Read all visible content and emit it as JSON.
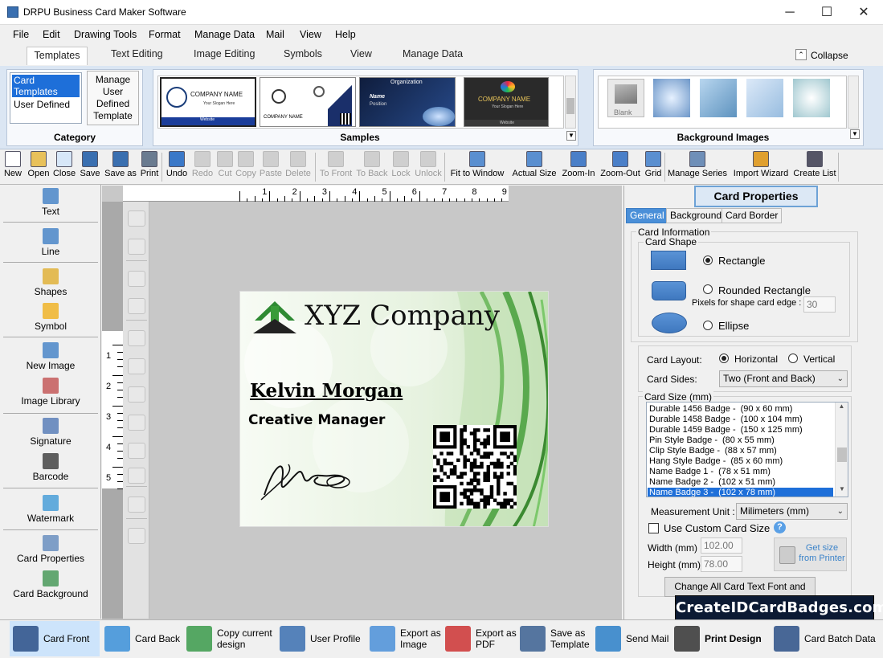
{
  "window": {
    "title": "DRPU Business Card Maker Software",
    "buttons": {
      "minimize": "─",
      "maximize": "☐",
      "close": "✕"
    }
  },
  "menubar": [
    "File",
    "Edit",
    "Drawing Tools",
    "Format",
    "Manage Data",
    "Mail",
    "View",
    "Help"
  ],
  "ribbon_tabs": {
    "active": "Templates",
    "items": [
      "Text Editing",
      "Image Editing",
      "Symbols",
      "View",
      "Manage Data"
    ],
    "collapse": "Collapse"
  },
  "category": {
    "label": "Category",
    "items": [
      "Card Templates",
      "User Defined"
    ],
    "manage_btn": [
      "Manage",
      "User",
      "Defined",
      "Template"
    ]
  },
  "samples": {
    "label": "Samples",
    "thumbs": [
      {
        "company": "COMPANY NAME",
        "slogan": "Your Slogan Here",
        "web": "Website"
      },
      {
        "company": "COMPANY NAME"
      },
      {
        "org": "Organization",
        "name": "Name",
        "pos": "Position"
      },
      {
        "company": "COMPANY NAME",
        "slogan": "Your Slogan Here",
        "web": "Website"
      }
    ]
  },
  "background_images": {
    "label": "Background Images",
    "blank": "Blank"
  },
  "toolbar": [
    {
      "id": "new",
      "label": "New",
      "icon": "new-file-icon",
      "enabled": true
    },
    {
      "id": "open",
      "label": "Open",
      "icon": "folder-icon",
      "enabled": true
    },
    {
      "id": "close",
      "label": "Close",
      "icon": "close-file-icon",
      "enabled": true
    },
    {
      "id": "save",
      "label": "Save",
      "icon": "floppy-icon",
      "enabled": true
    },
    {
      "id": "saveas",
      "label": "Save as",
      "icon": "save-as-icon",
      "enabled": true
    },
    {
      "id": "print",
      "label": "Print",
      "icon": "printer-icon",
      "enabled": true
    },
    {
      "id": "undo",
      "label": "Undo",
      "icon": "undo-icon",
      "enabled": true
    },
    {
      "id": "redo",
      "label": "Redo",
      "icon": "redo-icon",
      "enabled": false
    },
    {
      "id": "cut",
      "label": "Cut",
      "icon": "cut-icon",
      "enabled": false
    },
    {
      "id": "copy",
      "label": "Copy",
      "icon": "copy-icon",
      "enabled": false
    },
    {
      "id": "paste",
      "label": "Paste",
      "icon": "paste-icon",
      "enabled": false
    },
    {
      "id": "delete",
      "label": "Delete",
      "icon": "delete-icon",
      "enabled": false
    },
    {
      "id": "tofront",
      "label": "To Front",
      "icon": "to-front-icon",
      "enabled": false
    },
    {
      "id": "toback",
      "label": "To Back",
      "icon": "to-back-icon",
      "enabled": false
    },
    {
      "id": "lock",
      "label": "Lock",
      "icon": "lock-icon",
      "enabled": false
    },
    {
      "id": "unlock",
      "label": "Unlock",
      "icon": "unlock-icon",
      "enabled": false
    },
    {
      "id": "fit",
      "label": "Fit to Window",
      "icon": "fit-window-icon",
      "enabled": true
    },
    {
      "id": "actual",
      "label": "Actual Size",
      "icon": "actual-size-icon",
      "enabled": true
    },
    {
      "id": "zoomin",
      "label": "Zoom-In",
      "icon": "zoom-in-icon",
      "enabled": true
    },
    {
      "id": "zoomout",
      "label": "Zoom-Out",
      "icon": "zoom-out-icon",
      "enabled": true
    },
    {
      "id": "grid",
      "label": "Grid",
      "icon": "grid-icon",
      "enabled": true
    },
    {
      "id": "series",
      "label": "Manage Series",
      "icon": "manage-series-icon",
      "enabled": true
    },
    {
      "id": "wizard",
      "label": "Import Wizard",
      "icon": "import-wizard-icon",
      "enabled": true
    },
    {
      "id": "createlist",
      "label": "Create List",
      "icon": "create-list-icon",
      "enabled": true
    }
  ],
  "left_tools": [
    "Text",
    "Line",
    "Shapes",
    "Symbol",
    "New Image",
    "Image Library",
    "Signature",
    "Barcode",
    "Watermark",
    "Card Properties",
    "Card Background"
  ],
  "ruler": {
    "h": [
      "1",
      "2",
      "3",
      "4",
      "5",
      "6",
      "7",
      "8",
      "9"
    ],
    "v": [
      "1",
      "2",
      "3",
      "4",
      "5"
    ]
  },
  "card": {
    "company": "XYZ Company",
    "name": "Kelvin Morgan",
    "title": "Creative Manager"
  },
  "card_properties": {
    "title": "Card Properties",
    "tabs": [
      "General",
      "Background",
      "Card Border"
    ],
    "active_tab": "General",
    "card_information": "Card Information",
    "card_shape": "Card Shape",
    "shapes": [
      {
        "label": "Rectangle",
        "selected": true
      },
      {
        "label": "Rounded Rectangle",
        "selected": false
      },
      {
        "label": "Ellipse",
        "selected": false
      }
    ],
    "pixels_label": "Pixels for shape card edge :",
    "pixels_value": "30",
    "layout_label": "Card Layout:",
    "layout_options": [
      {
        "label": "Horizontal",
        "selected": true
      },
      {
        "label": "Vertical",
        "selected": false
      }
    ],
    "sides_label": "Card Sides:",
    "sides_value": "Two (Front and Back)",
    "size_label": "Card Size (mm)",
    "sizes": [
      {
        "name": "Durable 1456  Badge  -",
        "dim": "(90 x 60 mm)"
      },
      {
        "name": "Durable 1458  Badge  -",
        "dim": "(100 x 104 mm)"
      },
      {
        "name": "Durable 1459  Badge  -",
        "dim": "(150 x 125 mm)"
      },
      {
        "name": "Pin Style Badge  -",
        "dim": "(80 x 55 mm)"
      },
      {
        "name": "Clip Style Badge  -",
        "dim": "(88 x 57 mm)"
      },
      {
        "name": "Hang Style Badge  -",
        "dim": "(85 x 60 mm)"
      },
      {
        "name": "Name Badge 1  -",
        "dim": "(78 x 51 mm)"
      },
      {
        "name": "Name Badge 2  -",
        "dim": "(102 x 51 mm)"
      },
      {
        "name": "Name Badge 3  -",
        "dim": "(102 x 78 mm)"
      }
    ],
    "selected_size_index": 8,
    "unit_label": "Measurement Unit :",
    "unit_value": "Milimeters (mm)",
    "custom_size": "Use Custom Card Size",
    "width_label": "Width    (mm)",
    "width_value": "102.00",
    "height_label": "Height  (mm)",
    "height_value": "78.00",
    "get_size": [
      "Get size",
      "from Printer"
    ],
    "change_font": "Change All Card Text Font and Color"
  },
  "bottom_bar": [
    {
      "label": "Card Front",
      "icon": "card-front-icon",
      "selected": true
    },
    {
      "label": "Card Back",
      "icon": "card-back-icon"
    },
    {
      "label": "Copy current\ndesign",
      "icon": "copy-design-icon"
    },
    {
      "label": "User Profile",
      "icon": "user-profile-icon"
    },
    {
      "label": "Export as\nImage",
      "icon": "export-image-icon"
    },
    {
      "label": "Export as\nPDF",
      "icon": "export-pdf-icon"
    },
    {
      "label": "Save as\nTemplate",
      "icon": "save-template-icon"
    },
    {
      "label": "Send Mail",
      "icon": "send-mail-icon"
    },
    {
      "label": "Print Design",
      "icon": "print-design-icon"
    },
    {
      "label": "Card Batch Data",
      "icon": "batch-data-icon"
    }
  ],
  "watermark_brand": "CreateIDCardBadges.com",
  "colors": {
    "accent": "#4a8fd8",
    "selection": "#1e6fd9",
    "ribbon": "#dbe6f3",
    "card_green": "#3f9a3f"
  }
}
